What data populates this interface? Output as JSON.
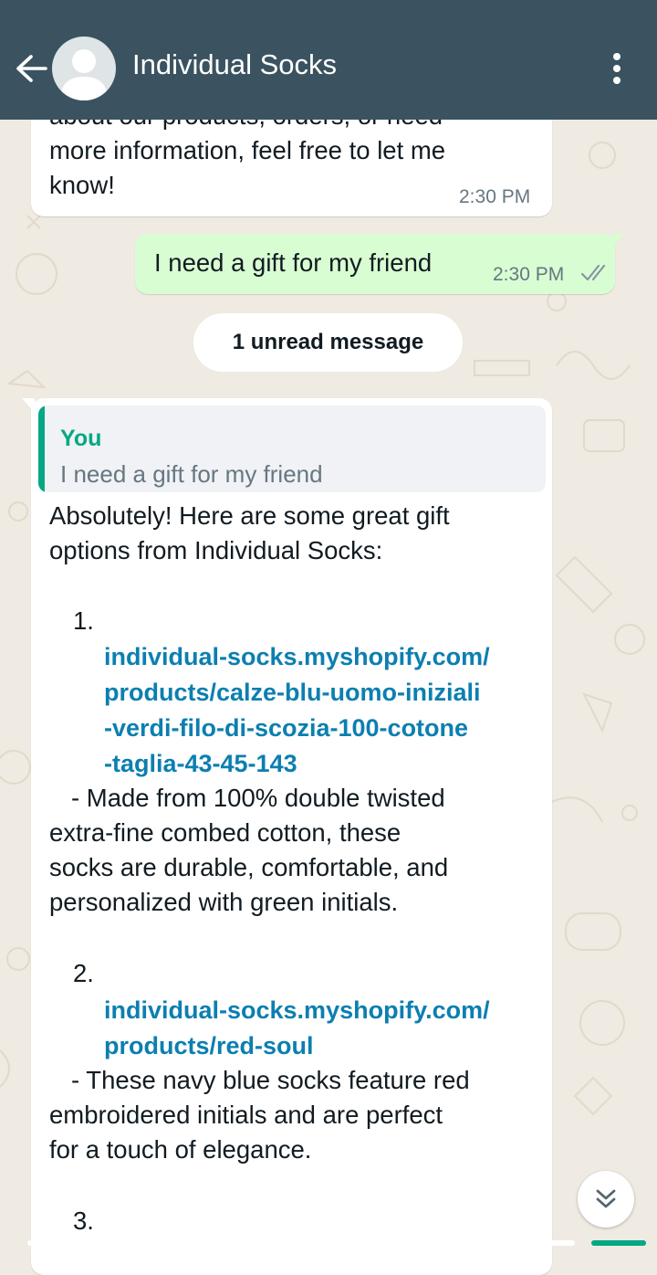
{
  "header": {
    "contact_name": "Individual Socks",
    "back_icon": "back-arrow-icon",
    "menu_icon": "more-vert-icon",
    "bg_color": "#3b5360"
  },
  "messages": {
    "prev_incoming": {
      "clipped_line": "about our products, orders, or need",
      "lines": [
        "more information, feel free to let me",
        "know!"
      ],
      "time": "2:30 PM"
    },
    "outgoing": {
      "text": "I need a gift for my friend",
      "time": "2:30 PM",
      "status_icon": "double-check-icon"
    },
    "unread_banner": "1 unread message",
    "reply": {
      "quote_author": "You",
      "quote_text": "I need a gift for my friend",
      "intro_lines": [
        "Absolutely! Here are some great gift",
        "options from Individual Socks:"
      ],
      "items": [
        {
          "number": "1.",
          "link_lines": [
            "individual-socks.myshopify.com/",
            "products/calze-blu-uomo-iniziali",
            "-verdi-filo-di-scozia-100-cotone",
            "-taglia-43-45-143"
          ],
          "desc_lines": [
            "- Made from 100% double twisted",
            "extra-fine combed cotton, these",
            "socks are durable, comfortable, and",
            "personalized with green initials."
          ]
        },
        {
          "number": "2.",
          "link_lines": [
            "individual-socks.myshopify.com/",
            "products/red-soul"
          ],
          "desc_lines": [
            "- These navy blue socks feature red",
            "embroidered initials and are perfect",
            "for a touch of elegance."
          ]
        },
        {
          "number": "3."
        }
      ]
    }
  },
  "colors": {
    "chat_bg": "#efeae2",
    "outgoing_bubble": "#d9fdd3",
    "link": "#0c7fb0",
    "quote_accent": "#06a884"
  },
  "scroll_button_icon": "double-chevron-down-icon"
}
